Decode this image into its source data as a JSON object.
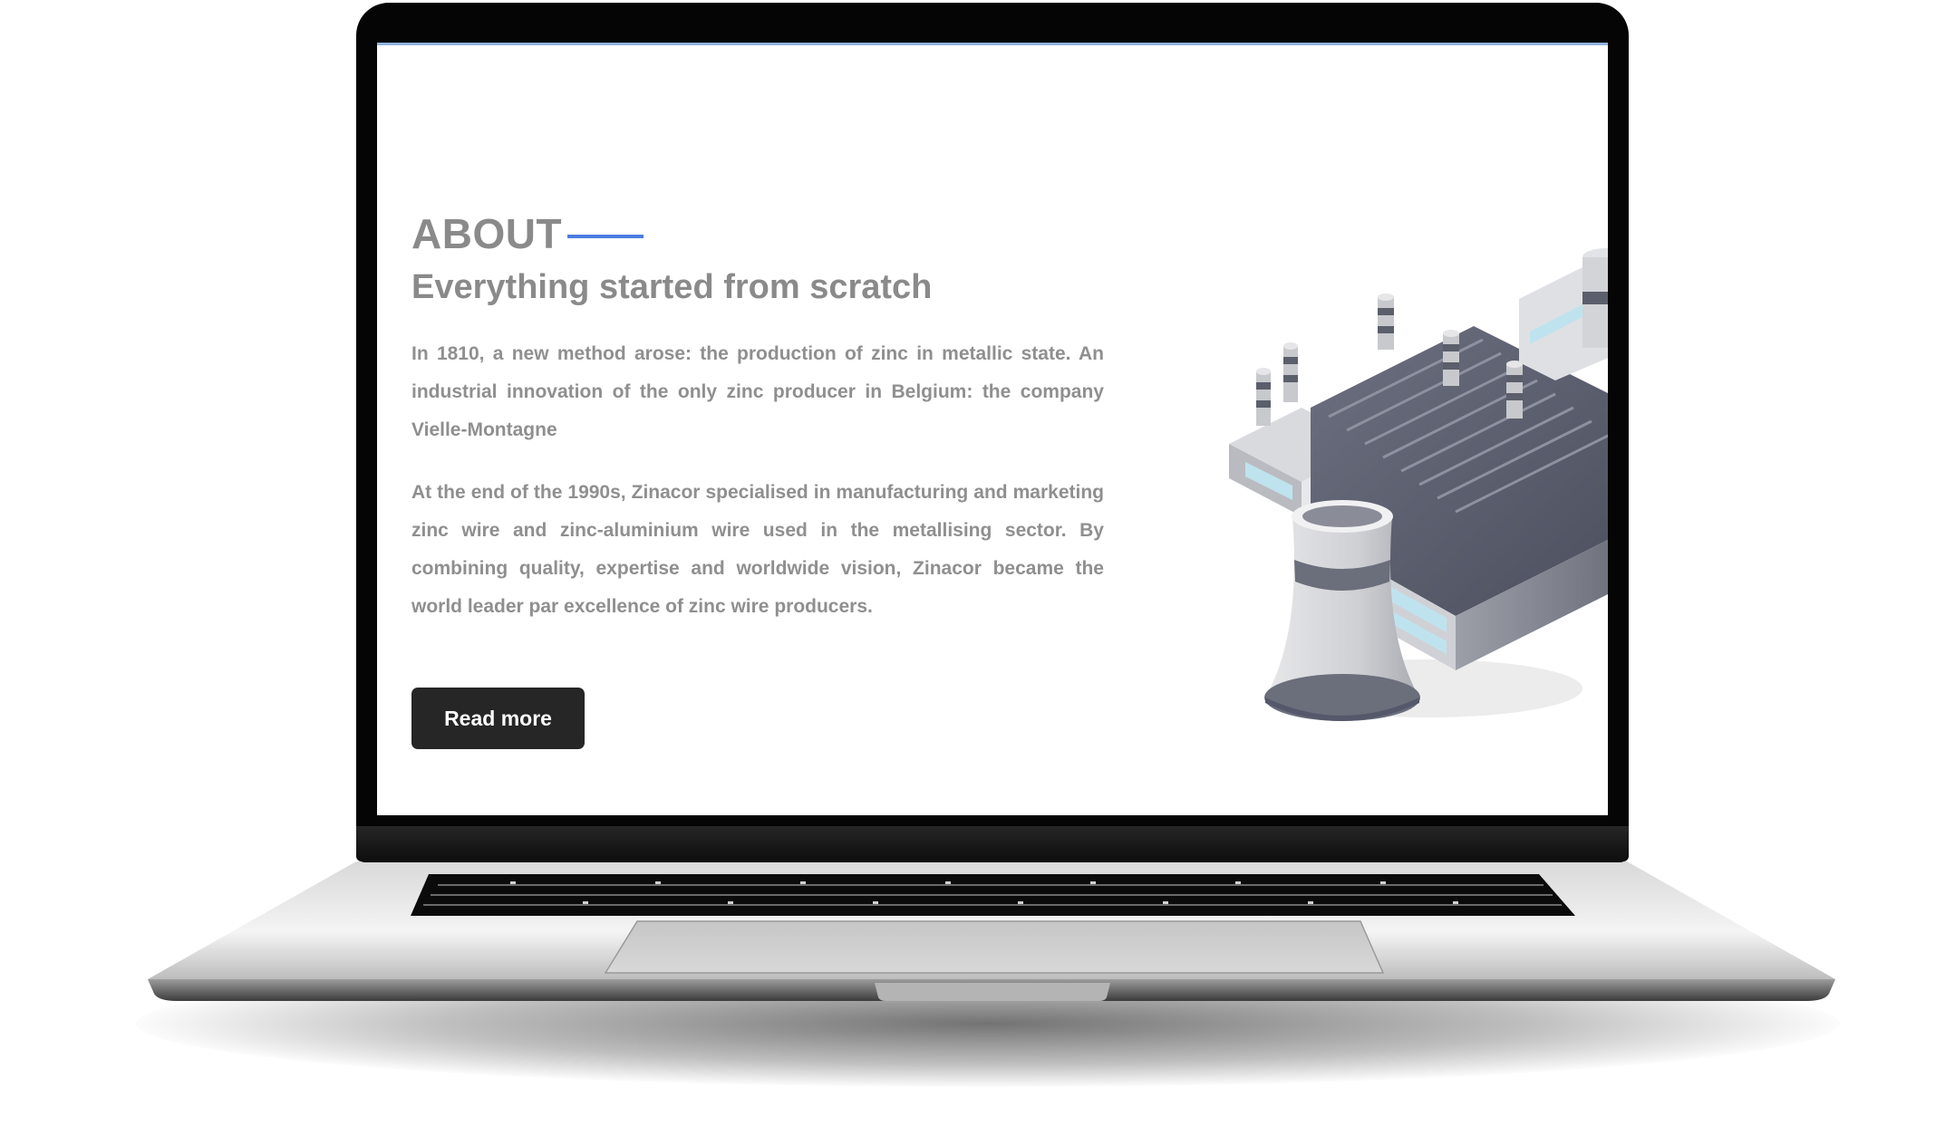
{
  "about": {
    "eyebrow": "ABOUT",
    "headline": "Everything started from scratch",
    "paragraph_1": "In 1810, a new method arose: the production of zinc in metallic state. An industrial innovation of the only zinc producer in Belgium: the company Vielle-Montagne",
    "paragraph_2": "At the end of the 1990s, Zinacor specialised in manufacturing and marketing zinc wire and zinc-aluminium wire used in the metallising sector. By combining quality, expertise and worldwide vision, Zinacor became the world leader par excellence of zinc wire producers.",
    "button_label": "Read more"
  },
  "illustration": {
    "icon": "factory-illustration"
  },
  "colors": {
    "accent": "#4d7be0",
    "text": "#8a8a8a",
    "button_bg": "#262626",
    "button_text": "#ffffff"
  }
}
